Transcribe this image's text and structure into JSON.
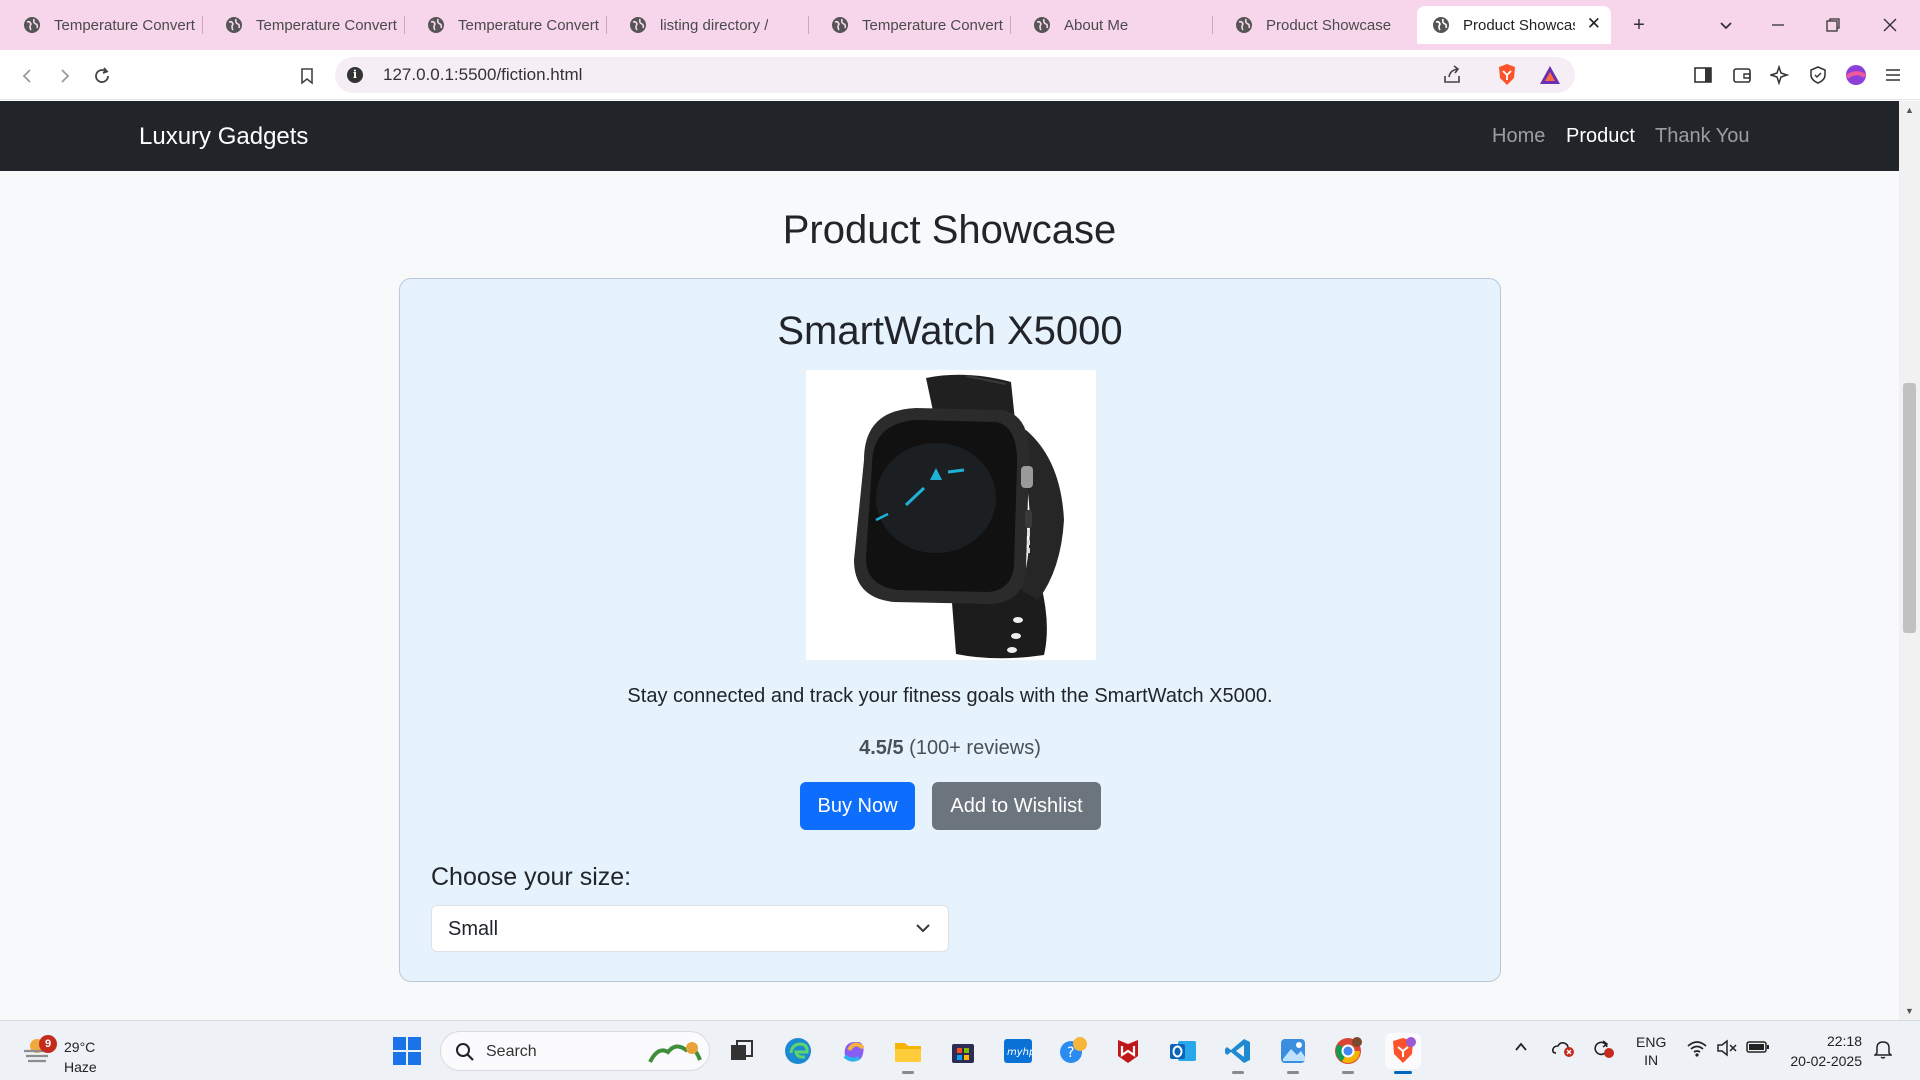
{
  "browser": {
    "tabs": [
      {
        "label": "Temperature Convert"
      },
      {
        "label": "Temperature Convert"
      },
      {
        "label": "Temperature Convert"
      },
      {
        "label": "listing directory /"
      },
      {
        "label": "Temperature Convert"
      },
      {
        "label": "About Me"
      },
      {
        "label": "Product Showcase"
      },
      {
        "label": "Product Showcas",
        "active": true
      }
    ],
    "url": "127.0.0.1:5500/fiction.html",
    "new_tab_glyph": "+",
    "close_glyph": "✕"
  },
  "site": {
    "brand": "Luxury Gadgets",
    "nav": [
      {
        "label": "Home",
        "active": false
      },
      {
        "label": "Product",
        "active": true
      },
      {
        "label": "Thank You",
        "active": false
      }
    ]
  },
  "page": {
    "title": "Product Showcase",
    "product": {
      "name": "SmartWatch X5000",
      "image_alt": "SmartWatch X5000",
      "description": "Stay connected and track your fitness goals with the SmartWatch X5000.",
      "rating_score": "4.5/5",
      "rating_reviews": "(100+ reviews)",
      "buy_label": "Buy Now",
      "wishlist_label": "Add to Wishlist",
      "size_label": "Choose your size:",
      "size_selected": "Small"
    }
  },
  "taskbar": {
    "weather_temp": "29°C",
    "weather_cond": "Haze",
    "weather_badge": "9",
    "search_label": "Search",
    "lang_line1": "ENG",
    "lang_line2": "IN",
    "time": "22:18",
    "date": "20-02-2025"
  },
  "colors": {
    "tabstrip": "#f7d6ec",
    "navbar": "#212529",
    "card": "#e6f2fc",
    "primary": "#0d6efd",
    "secondary": "#6c757d"
  }
}
